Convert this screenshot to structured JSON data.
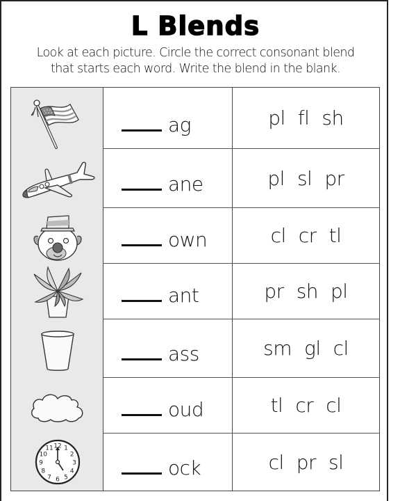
{
  "worksheet": {
    "title": "L Blends",
    "instructions_line1": "Look at each picture. Circle the correct consonant blend",
    "instructions_line2": "that starts each word. Write the blend in the blank."
  },
  "blank_placeholder": "____",
  "rows": [
    {
      "picture": "flag-icon",
      "word_ending": "ag",
      "choices": [
        "pl",
        "fl",
        "sh"
      ]
    },
    {
      "picture": "airplane-icon",
      "word_ending": "ane",
      "choices": [
        "pl",
        "sl",
        "pr"
      ]
    },
    {
      "picture": "clown-icon",
      "word_ending": "own",
      "choices": [
        "cl",
        "cr",
        "tl"
      ]
    },
    {
      "picture": "plant-icon",
      "word_ending": "ant",
      "choices": [
        "pr",
        "sh",
        "pl"
      ]
    },
    {
      "picture": "glass-icon",
      "word_ending": "ass",
      "choices": [
        "sm",
        "gl",
        "cl"
      ]
    },
    {
      "picture": "cloud-icon",
      "word_ending": "oud",
      "choices": [
        "tl",
        "cr",
        "cl"
      ]
    },
    {
      "picture": "clock-icon",
      "word_ending": "ock",
      "choices": [
        "cl",
        "pr",
        "sl"
      ]
    }
  ],
  "clock_numbers": [
    "12",
    "1",
    "2",
    "3",
    "4",
    "5",
    "6",
    "7",
    "8",
    "9",
    "10",
    "11"
  ]
}
